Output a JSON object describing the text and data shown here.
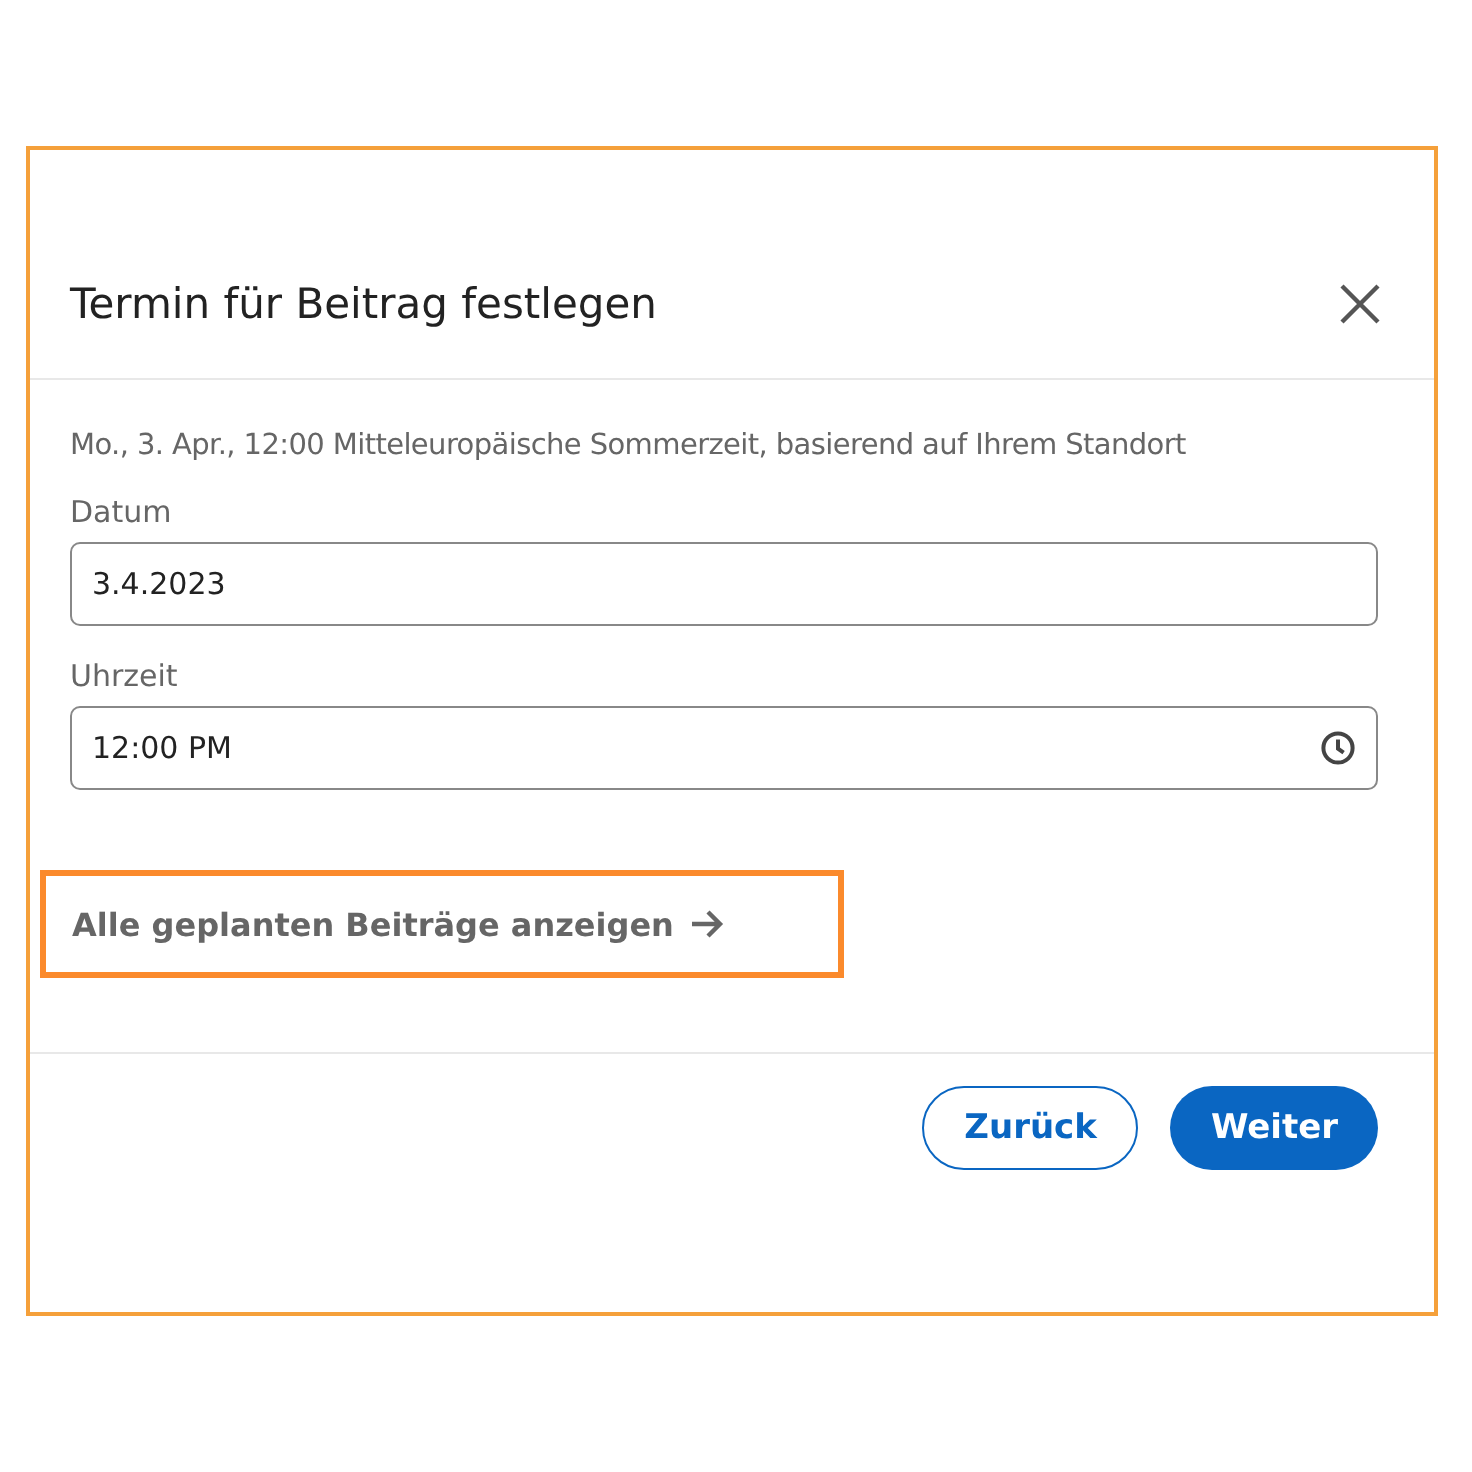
{
  "dialog": {
    "title": "Termin für Beitrag festlegen",
    "summary": "Mo., 3. Apr., 12:00 Mitteleuropäische Sommerzeit, basierend auf Ihrem Standort",
    "fields": [
      {
        "label": "Datum",
        "value": "3.4.2023",
        "kind": "date"
      },
      {
        "label": "Uhrzeit",
        "value": "12:00 PM",
        "kind": "time"
      }
    ],
    "link": {
      "label": "Alle geplanten Beiträge anzeigen",
      "highlighted": true
    },
    "buttons": [
      {
        "label": "Zurück",
        "kind": "secondary"
      },
      {
        "label": "Weiter",
        "kind": "primary"
      }
    ]
  }
}
